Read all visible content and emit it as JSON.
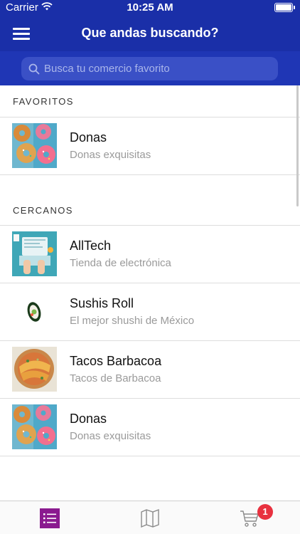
{
  "status_bar": {
    "carrier": "Carrier",
    "time": "10:25 AM"
  },
  "header": {
    "title": "Que andas buscando?"
  },
  "search": {
    "placeholder": "Busca tu comercio favorito"
  },
  "sections": {
    "favorites": {
      "title": "FAVORITOS",
      "items": [
        {
          "name": "Donas",
          "description": "Donas exquisitas",
          "image": "donuts-image"
        }
      ]
    },
    "nearby": {
      "title": "CERCANOS",
      "items": [
        {
          "name": "AllTech",
          "description": "Tienda de electrónica",
          "image": "electronics-image"
        },
        {
          "name": "Sushis Roll",
          "description": "El mejor shushi de México",
          "image": "sushi-image"
        },
        {
          "name": "Tacos Barbacoa",
          "description": "Tacos de Barbacoa",
          "image": "tacos-image"
        },
        {
          "name": "Donas",
          "description": "Donas exquisitas",
          "image": "donuts-image"
        }
      ]
    }
  },
  "tab_bar": {
    "tabs": [
      {
        "icon": "list-icon",
        "active": true
      },
      {
        "icon": "map-icon",
        "active": false
      },
      {
        "icon": "cart-icon",
        "active": false,
        "badge": "1"
      }
    ]
  },
  "colors": {
    "header_bg": "#1a2fa8",
    "active_tab": "#8a1a8f",
    "badge": "#e8313f"
  }
}
